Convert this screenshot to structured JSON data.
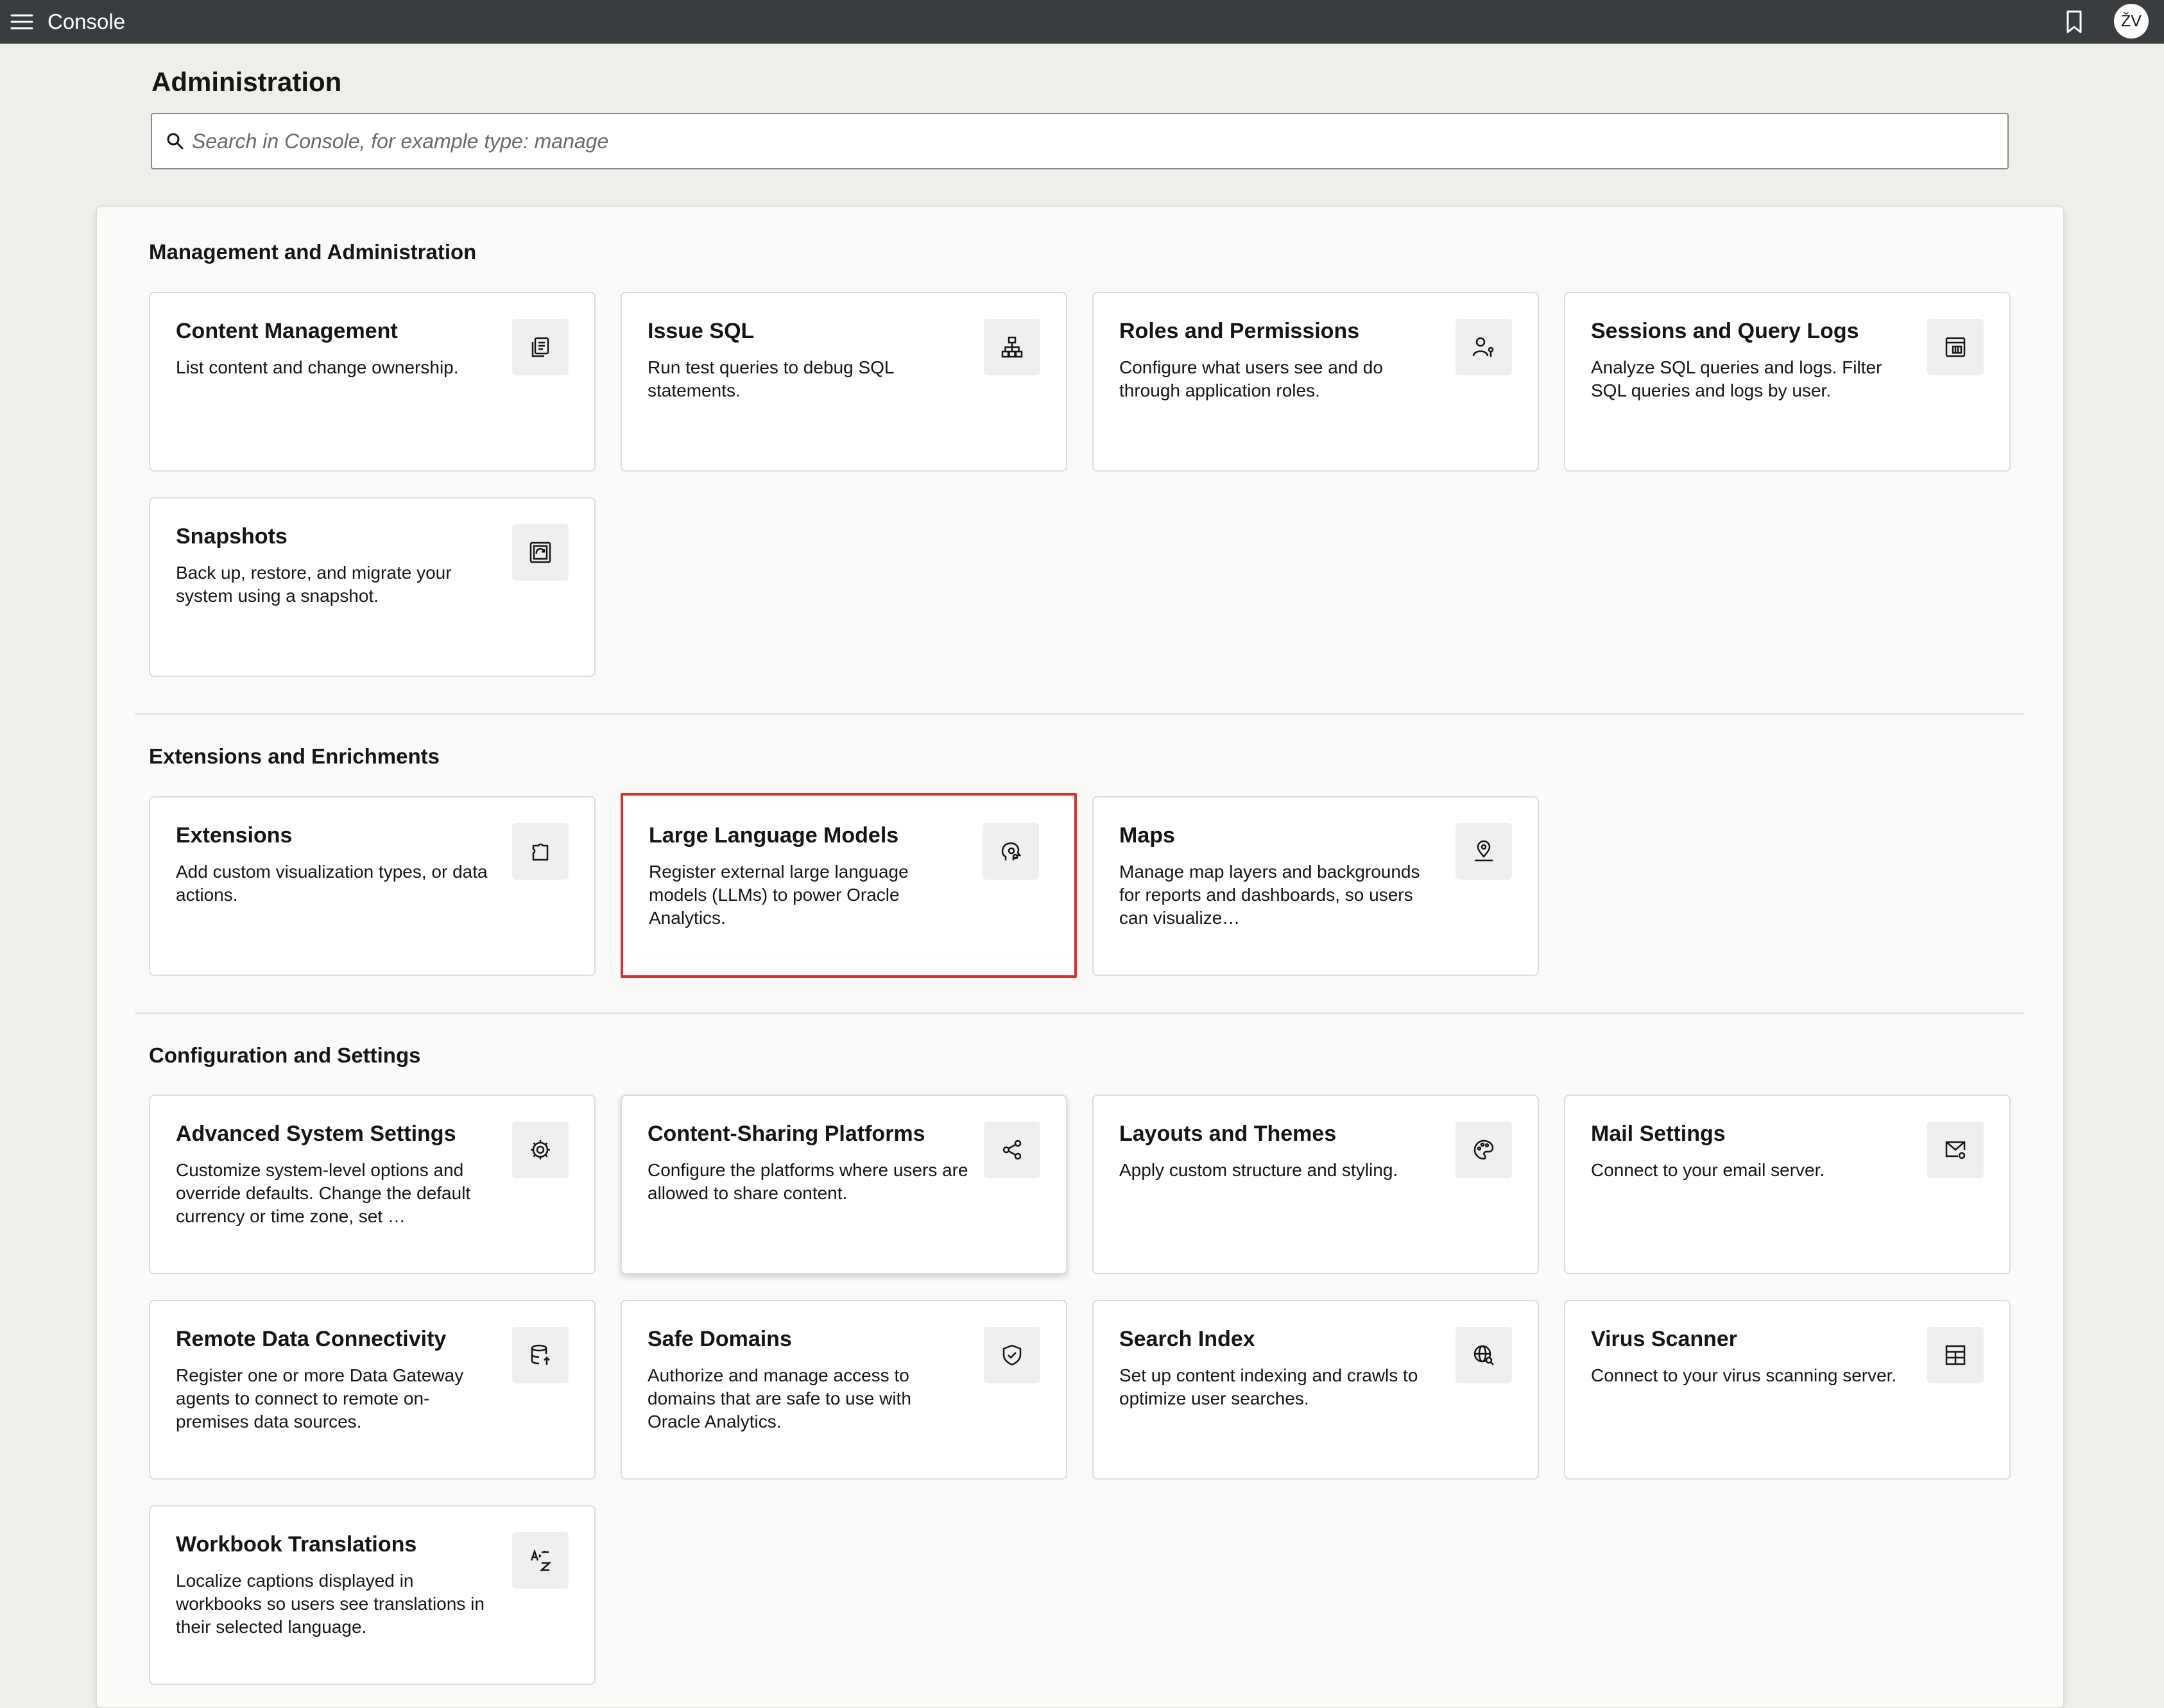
{
  "header": {
    "title": "Console",
    "avatar_initials": "ŽV"
  },
  "page": {
    "title": "Administration"
  },
  "search": {
    "placeholder": "Search in Console, for example type: manage",
    "value": ""
  },
  "sections": [
    {
      "title": "Management and Administration",
      "cards": [
        {
          "title": "Content Management",
          "description": "List content and change ownership.",
          "icon": "content-management-icon"
        },
        {
          "title": "Issue SQL",
          "description": "Run test queries to debug SQL statements.",
          "icon": "sql-hierarchy-icon"
        },
        {
          "title": "Roles and Permissions",
          "description": "Configure what users see and do through application roles.",
          "icon": "user-roles-icon"
        },
        {
          "title": "Sessions and Query Logs",
          "description": "Analyze SQL queries and logs. Filter SQL queries and logs by user.",
          "icon": "query-logs-icon"
        },
        {
          "title": "Snapshots",
          "description": "Back up, restore, and migrate your system using a snapshot.",
          "icon": "snapshot-icon"
        }
      ]
    },
    {
      "title": "Extensions and Enrichments",
      "cards": [
        {
          "title": "Extensions",
          "description": "Add custom visualization types, or data actions.",
          "icon": "puzzle-piece-icon"
        },
        {
          "title": "Large Language Models",
          "description": "Register external large language models (LLMs) to power Oracle Analytics.",
          "icon": "ai-brain-icon"
        },
        {
          "title": "Maps",
          "description": "Manage map layers and backgrounds for reports and dashboards, so users can visualize…",
          "icon": "map-pin-icon"
        }
      ]
    },
    {
      "title": "Configuration and Settings",
      "cards": [
        {
          "title": "Advanced System Settings",
          "description": "Customize system-level options and override defaults. Change the default currency or time zone, set …",
          "icon": "gear-icon"
        },
        {
          "title": "Content-Sharing Platforms",
          "description": "Configure the platforms where users are allowed to share content.",
          "icon": "share-icon"
        },
        {
          "title": "Layouts and Themes",
          "description": "Apply custom structure and styling.",
          "icon": "palette-icon"
        },
        {
          "title": "Mail Settings",
          "description": "Connect to your email server.",
          "icon": "mail-settings-icon"
        },
        {
          "title": "Remote Data Connectivity",
          "description": "Register one or more Data Gateway agents to connect to remote on-premises data sources.",
          "icon": "database-upload-icon"
        },
        {
          "title": "Safe Domains",
          "description": "Authorize and manage access to domains that are safe to use with Oracle Analytics.",
          "icon": "shield-check-icon"
        },
        {
          "title": "Search Index",
          "description": "Set up content indexing and crawls to optimize user searches.",
          "icon": "globe-search-icon"
        },
        {
          "title": "Virus Scanner",
          "description": "Connect to your virus scanning server.",
          "icon": "scanner-grid-icon"
        },
        {
          "title": "Workbook Translations",
          "description": "Localize captions displayed in workbooks so users see translations in their selected language.",
          "icon": "translate-icon"
        }
      ]
    }
  ],
  "colors": {
    "topbar": "#3a3d40",
    "selected_outline": "#d9322b",
    "background": "#efeeeb"
  }
}
